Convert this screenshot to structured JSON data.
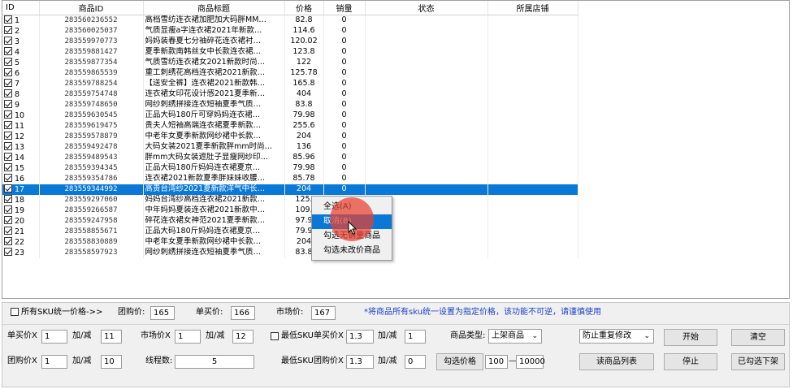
{
  "table": {
    "headers": [
      "ID",
      "商品ID",
      "商品标题",
      "价格",
      "销量",
      "状态",
      "所属店铺"
    ],
    "rows": [
      {
        "id": "1",
        "pid": "283560236552",
        "title": "高档雪纺连衣裙加肥加大码胖MM…",
        "price": "82.8",
        "sales": "0",
        "checked": true
      },
      {
        "id": "2",
        "pid": "283560025037",
        "title": "气质显瘦a字连衣裙2021年新款…",
        "price": "114.6",
        "sales": "0",
        "checked": true
      },
      {
        "id": "3",
        "pid": "283559970773",
        "title": "妈妈装春夏七分袖碎花连衣裙衬…",
        "price": "120.02",
        "sales": "0",
        "checked": true
      },
      {
        "id": "4",
        "pid": "283559881427",
        "title": "夏季新款南韩丝女中长款连衣裙…",
        "price": "123.8",
        "sales": "0",
        "checked": true
      },
      {
        "id": "5",
        "pid": "283559877354",
        "title": "气质雪纺连衣裙女2021新款时尚…",
        "price": "122",
        "sales": "0",
        "checked": true
      },
      {
        "id": "6",
        "pid": "283559865539",
        "title": "重工刺绣花高档连衣裙2021新款…",
        "price": "125.78",
        "sales": "0",
        "checked": true
      },
      {
        "id": "7",
        "pid": "283559788254",
        "title": "【送安全裤】连衣裙2021新款韩…",
        "price": "165.8",
        "sales": "0",
        "checked": true
      },
      {
        "id": "8",
        "pid": "283559754748",
        "title": "连衣裙女印花设计感2021夏季新…",
        "price": "404",
        "sales": "0",
        "checked": true
      },
      {
        "id": "9",
        "pid": "283559748650",
        "title": "网纱刺绣拼接连衣短袖夏季气质…",
        "price": "83.8",
        "sales": "0",
        "checked": true
      },
      {
        "id": "10",
        "pid": "283559630545",
        "title": "正品大码180斤可穿妈妈连衣裙…",
        "price": "79.98",
        "sales": "0",
        "checked": true
      },
      {
        "id": "11",
        "pid": "283559619475",
        "title": "贵夫人短袖高端连衣裙夏季新款…",
        "price": "255.6",
        "sales": "0",
        "checked": true
      },
      {
        "id": "12",
        "pid": "283559578879",
        "title": "中老年女夏季新款网纱裙中长款…",
        "price": "204",
        "sales": "0",
        "checked": true
      },
      {
        "id": "13",
        "pid": "283559492478",
        "title": "大码女装2021夏季新款胖mm时尚…",
        "price": "136",
        "sales": "0",
        "checked": true
      },
      {
        "id": "14",
        "pid": "283559489543",
        "title": "胖mm大码女装遮肚子显瘦网纱印…",
        "price": "85.96",
        "sales": "0",
        "checked": true
      },
      {
        "id": "15",
        "pid": "283559394345",
        "title": "正品大码180斤妈妈连衣裙夏京…",
        "price": "79.98",
        "sales": "0",
        "checked": true
      },
      {
        "id": "16",
        "pid": "283559354786",
        "title": "连衣裙2021新款夏季胖妹妹收腰…",
        "price": "85.78",
        "sales": "0",
        "checked": true
      },
      {
        "id": "17",
        "pid": "283559344992",
        "title": "高贵台湾纱2021夏新款洋气中长…",
        "price": "204",
        "sales": "0",
        "checked": true
      },
      {
        "id": "18",
        "pid": "283559297060",
        "title": "妈妈台湾纱高档连衣裙2021新款…",
        "price": "125.",
        "sales": "0",
        "checked": true
      },
      {
        "id": "19",
        "pid": "283559266587",
        "title": "中年妈妈夏装连衣裙2021新款中…",
        "price": "109.",
        "sales": "0",
        "checked": true
      },
      {
        "id": "20",
        "pid": "283559247958",
        "title": "碎花连衣裙女神范2021夏季新款…",
        "price": "97.9",
        "sales": "0",
        "checked": true
      },
      {
        "id": "21",
        "pid": "283558855671",
        "title": "正品大码180斤妈妈连衣裙夏京…",
        "price": "79.9",
        "sales": "0",
        "checked": true
      },
      {
        "id": "22",
        "pid": "283558830889",
        "title": "中老年女夏季新款网纱裙中长款…",
        "price": "204",
        "sales": "0",
        "checked": true
      },
      {
        "id": "23",
        "pid": "283558597923",
        "title": "网纱刺绣拼接连衣短袖夏季气质…",
        "price": "83.8",
        "sales": "0",
        "checked": true
      }
    ],
    "selected_row_id": "17"
  },
  "context_menu": {
    "items": [
      "全选(A)",
      "取消(B)",
      "勾选无销量商品",
      "勾选未改价商品"
    ],
    "highlighted_index": 1
  },
  "sku_row": {
    "checkbox_label": "所有SKU统一价格->>",
    "checked": false,
    "group_price_label": "团购价:",
    "group_price_value": "165",
    "single_price_label": "单买价:",
    "single_price_value": "166",
    "market_price_label": "市场价:",
    "market_price_value": "167",
    "note": "*将商品所有sku统一设置为指定价格，该功能不可逆，请谨慎使用",
    "note_color": "#1a3fc9"
  },
  "row1": {
    "single_price_label": "单买价X",
    "single_price_mult": "1",
    "adjust_label_1": "加/减",
    "single_price_adj": "11",
    "market_price_label": "市场价X",
    "market_price_mult": "1",
    "adjust_label_2": "加/减",
    "market_price_adj": "12",
    "min_sku_label": "最低SKU单买价X",
    "min_sku_checked": false,
    "min_sku_mult": "1.3",
    "adjust_label_3": "加/减",
    "min_sku_adj": "1",
    "type_label": "商品类型:",
    "type_value": "上架商品",
    "mode_value": "防止重复修改",
    "start_button": "开始",
    "clear_button": "清空"
  },
  "row2": {
    "group_price_label": "团购价X",
    "group_price_mult": "1",
    "adjust_label_1": "加/减",
    "group_price_adj": "10",
    "thread_label": "线程数:",
    "thread_value": "5",
    "min_sku_group_label": "最低SKU团购价X",
    "min_sku_group_mult": "1.3",
    "adjust_label_2": "加/减",
    "min_sku_group_adj": "0",
    "check_price_button": "勾选价格",
    "range_min": "100",
    "range_sep": "—",
    "range_max": "10000",
    "read_list_button": "读商品列表",
    "stop_button": "停止",
    "delist_button": "已勾选下架"
  }
}
